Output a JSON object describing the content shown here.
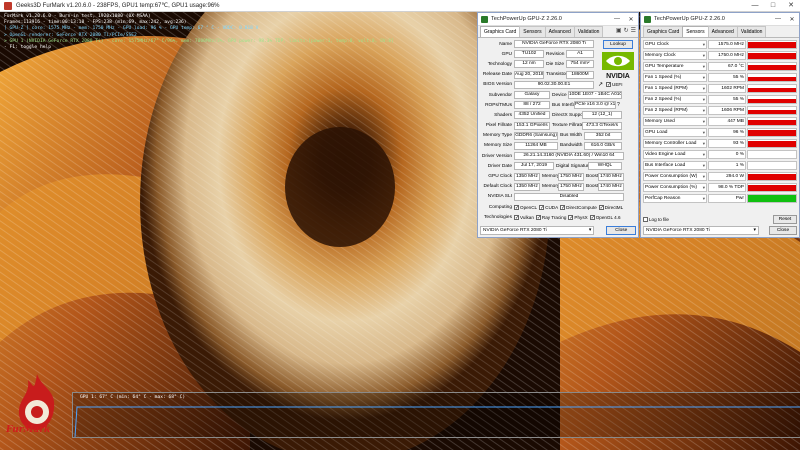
{
  "furmark": {
    "title": "Geeks3D FurMark v1.20.6.0 - 238FPS, GPU1 temp:67℃, GPU1 usage:96%",
    "overlay": [
      {
        "text": "FurMark v1.20.6.0 - Burn-in test, 1920x1080 (0X MSAA)",
        "color": "white"
      },
      {
        "text": "Frames:113916 - time:00:13:18 - FPS:238 (min:69, max:242, avg:236)",
        "color": "white"
      },
      {
        "text": "[ GPU-Z ] core: 1575 MHz - mem: 1750 MHz - GPU load: 96 % - GPU temp: 67 ° C - VDDC: 0.818 V",
        "color": "cyan"
      },
      {
        "text": "> OpenGL renderer: GeForce RTX 2080 Ti/PCIe/SSE2",
        "color": "cyan"
      },
      {
        "text": "> GPU 1 (NVIDIA GeForce RTX 2080 Ti) - core: 1575MHz/67° C/96%, mem: 7000MHz/3%, GPU power: 98.3% TDP, limits:[power:1, temp:0, volt:0, OV:0]",
        "color": "green"
      },
      {
        "text": "- F1: toggle help",
        "color": "white"
      }
    ],
    "temp_graph_label": "GPU 1: 67° C (min: 64° C - max: 68° C)",
    "logo_text": "FurMark"
  },
  "gpuz_card": {
    "title": "TechPowerUp GPU-Z 2.26.0",
    "tabs": [
      "Graphics Card",
      "Sensors",
      "Advanced",
      "Validation"
    ],
    "active_tab": 0,
    "lookup_label": "Lookup",
    "uefi_label": "UEFI",
    "rows": {
      "name": {
        "label": "Name",
        "value": "NVIDIA GeForce RTX 2080 Ti"
      },
      "gpu": {
        "label": "GPU",
        "value": "TU102"
      },
      "revision": {
        "label": "Revision",
        "value": "A1"
      },
      "technology": {
        "label": "Technology",
        "value": "12 nm"
      },
      "die_size": {
        "label": "Die Size",
        "value": "754 mm²"
      },
      "release_date": {
        "label": "Release Date",
        "value": "Aug 20, 2018"
      },
      "transistors": {
        "label": "Transistors",
        "value": "18600M"
      },
      "bios": {
        "label": "BIOS Version",
        "value": "90.02.30.00.E1"
      },
      "subvendor": {
        "label": "Subvendor",
        "value": "Galaxy"
      },
      "device_id": {
        "label": "Device ID",
        "value": "10DE 1E07 - 1B4C A010"
      },
      "rops": {
        "label": "ROPs/TMUs",
        "value": "88 / 272"
      },
      "bus_interface": {
        "label": "Bus Interface",
        "value": "PCIe x16 3.0 @ x16 3.0"
      },
      "shaders": {
        "label": "Shaders",
        "value": "4352 Unified"
      },
      "directx": {
        "label": "DirectX Support",
        "value": "12 (12_1)"
      },
      "pixel_fillrate": {
        "label": "Pixel Fillrate",
        "value": "153.1 GPixel/s"
      },
      "texture_fillrate": {
        "label": "Texture Fillrate",
        "value": "473.3 GTexel/s"
      },
      "memory_type": {
        "label": "Memory Type",
        "value": "GDDR6 (Samsung)"
      },
      "bus_width": {
        "label": "Bus Width",
        "value": "352 bit"
      },
      "memory_size": {
        "label": "Memory Size",
        "value": "11264 MB"
      },
      "bandwidth": {
        "label": "Bandwidth",
        "value": "616.0 GB/s"
      },
      "driver_version": {
        "label": "Driver Version",
        "value": "26.21.14.3160 (NVIDIA 431.60) / Win10 64"
      },
      "driver_date": {
        "label": "Driver Date",
        "value": "Jul 17, 2019"
      },
      "digital_signature": {
        "label": "Digital Signature",
        "value": "WHQL"
      },
      "gpu_clock": {
        "label": "GPU Clock",
        "value": "1350 MHz"
      },
      "gpu_memory": {
        "label": "Memory",
        "value": "1750 MHz"
      },
      "gpu_boost": {
        "label": "Boost",
        "value": "1740 MHz"
      },
      "default_clock": {
        "label": "Default Clock",
        "value": "1350 MHz"
      },
      "default_memory": {
        "label": "Memory",
        "value": "1750 MHz"
      },
      "default_boost": {
        "label": "Boost",
        "value": "1740 MHz"
      },
      "sli": {
        "label": "NVIDIA SLI",
        "value": "Disabled"
      }
    },
    "computing_label": "Computing",
    "computing": [
      {
        "label": "OpenCL",
        "checked": true
      },
      {
        "label": "CUDA",
        "checked": true
      },
      {
        "label": "DirectCompute",
        "checked": true
      },
      {
        "label": "DirectML",
        "checked": true
      }
    ],
    "technologies_label": "Technologies",
    "technologies": [
      {
        "label": "Vulkan",
        "checked": true
      },
      {
        "label": "Ray Tracing",
        "checked": true
      },
      {
        "label": "PhysX",
        "checked": true
      },
      {
        "label": "OpenGL 4.6",
        "checked": true
      }
    ],
    "gpu_select": "NVIDIA GeForce RTX 2080 Ti",
    "close_label": "Close"
  },
  "gpuz_sensors": {
    "title": "TechPowerUp GPU-Z 2.26.0",
    "tabs": [
      "Graphics Card",
      "Sensors",
      "Advanced",
      "Validation"
    ],
    "active_tab": 1,
    "sensors": [
      {
        "label": "GPU Clock",
        "value": "1575.0 MHz",
        "level": 0.85,
        "color": "red"
      },
      {
        "label": "Memory Clock",
        "value": "1750.0 MHz",
        "level": 0.85,
        "color": "red"
      },
      {
        "label": "GPU Temperature",
        "value": "67.0 °C",
        "level": 0.7,
        "color": "red"
      },
      {
        "label": "Fan 1 Speed (%)",
        "value": "55 %",
        "level": 0.55,
        "color": "red"
      },
      {
        "label": "Fan 1 Speed (RPM)",
        "value": "1602 RPM",
        "level": 0.55,
        "color": "red"
      },
      {
        "label": "Fan 2 Speed (%)",
        "value": "55 %",
        "level": 0.55,
        "color": "red"
      },
      {
        "label": "Fan 2 Speed (RPM)",
        "value": "1606 RPM",
        "level": 0.55,
        "color": "red"
      },
      {
        "label": "Memory Used",
        "value": "447 MB",
        "level": 0.75,
        "color": "red"
      },
      {
        "label": "GPU Load",
        "value": "96 %",
        "level": 0.9,
        "color": "red"
      },
      {
        "label": "Memory Controller Load",
        "value": "93 %",
        "level": 0.85,
        "color": "red"
      },
      {
        "label": "Video Engine Load",
        "value": "0 %",
        "level": 0,
        "color": "red"
      },
      {
        "label": "Bus Interface Load",
        "value": "1 %",
        "level": 0.05,
        "color": "red"
      },
      {
        "label": "Power Consumption (W)",
        "value": "294.0 W",
        "level": 0.85,
        "color": "red"
      },
      {
        "label": "Power Consumption (%)",
        "value": "98.0 % TDP",
        "level": 0.85,
        "color": "red"
      },
      {
        "label": "PerfCap Reason",
        "value": "Pwr",
        "level": 1,
        "color": "green"
      }
    ],
    "log_label": "Log to file",
    "reset_label": "Reset",
    "gpu_select": "NVIDIA GeForce RTX 2080 Ti",
    "close_label": "Close"
  }
}
